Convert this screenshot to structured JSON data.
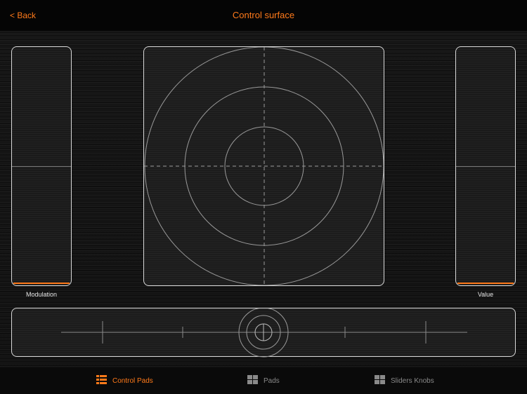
{
  "nav": {
    "back_label": "< Back",
    "title": "Control surface"
  },
  "left_slider": {
    "label": "Modulation",
    "value": 0.0
  },
  "right_slider": {
    "label": "Value",
    "value": 0.0
  },
  "tabs": [
    {
      "label": "Control Pads",
      "active": true,
      "icon": "grid-icon"
    },
    {
      "label": "Pads",
      "active": false,
      "icon": "grid-icon"
    },
    {
      "label": "Sliders Knobs",
      "active": false,
      "icon": "grid-icon"
    }
  ],
  "colors": {
    "accent": "#ff7a1a",
    "border": "#d8d8d8",
    "inactive": "#8a8a8a"
  }
}
